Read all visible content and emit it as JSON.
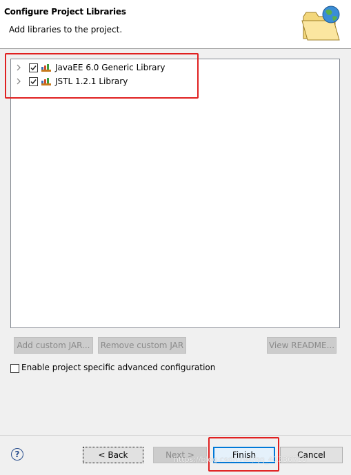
{
  "header": {
    "title": "Configure Project Libraries",
    "subtitle": "Add libraries to the project."
  },
  "libraries": [
    {
      "label": "JavaEE 6.0 Generic Library",
      "checked": true
    },
    {
      "label": "JSTL 1.2.1 Library",
      "checked": true
    }
  ],
  "buttons": {
    "add_custom_jar": "Add custom JAR...",
    "remove_custom_jar": "Remove custom JAR",
    "view_readme": "View README..."
  },
  "options": {
    "enable_advanced": "Enable project specific advanced configuration"
  },
  "footer": {
    "help": "?",
    "back": "< Back",
    "next": "Next >",
    "finish": "Finish",
    "cancel": "Cancel"
  },
  "watermark": "https://blog.csdn.net/qq_41336713",
  "colors": {
    "highlight": "#e02020",
    "default_button_border": "#0078d7"
  }
}
